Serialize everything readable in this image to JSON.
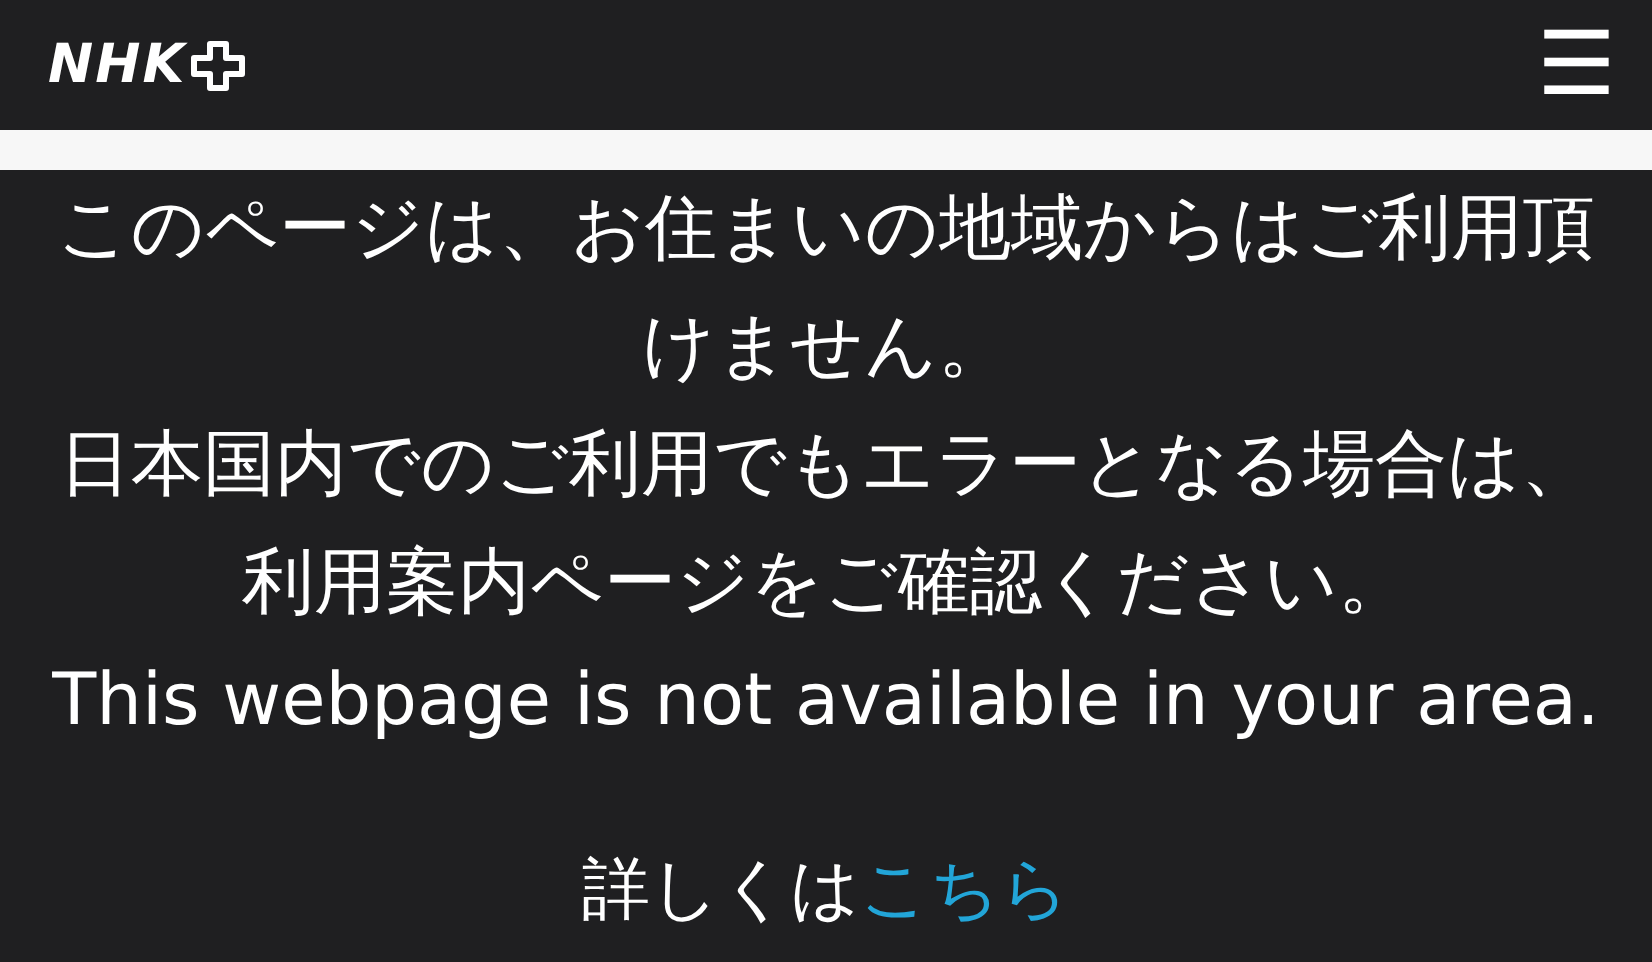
{
  "header": {
    "logo": "NHK",
    "menu_icon": "☰"
  },
  "messages": [
    "このページは、お住まいの地域からはご利用頂けません。",
    "日本国内でのご利用でもエラーとなる場合は、利用案内ページをご確認ください。",
    "This webpage is not available in your area."
  ],
  "details": {
    "text": "詳しくは",
    "link": "こちら"
  }
}
